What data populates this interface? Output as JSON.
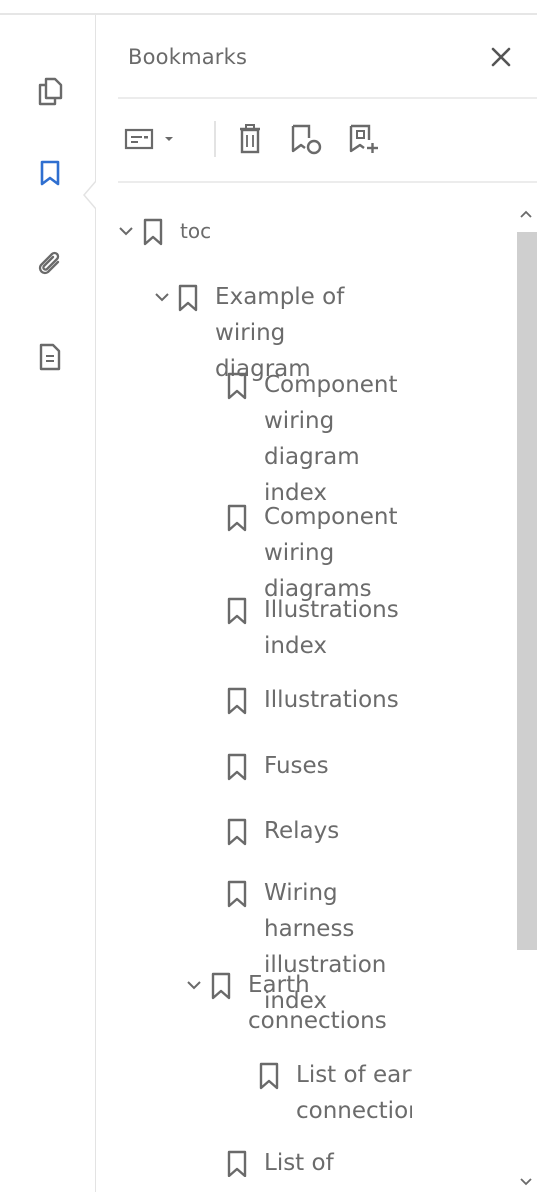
{
  "panel": {
    "title": "Bookmarks"
  },
  "colors": {
    "accent": "#2f6fd0",
    "icon": "#6a6a6a",
    "scroll_thumb": "#cfcfcf"
  },
  "rail": {
    "items": [
      {
        "name": "page-thumbnails-icon",
        "active": false
      },
      {
        "name": "bookmarks-icon",
        "active": true
      },
      {
        "name": "attachments-icon",
        "active": false
      },
      {
        "name": "document-properties-icon",
        "active": false
      }
    ]
  },
  "toolbar": {
    "buttons": [
      "options-icon",
      "delete-bookmark-icon",
      "new-bookmark-icon",
      "new-bookmark-from-structure-icon"
    ]
  },
  "tree": [
    {
      "label": "toc",
      "lines": [
        "toc"
      ],
      "expandable": true,
      "expanded": true
    },
    {
      "label": "Example of wiring diagram",
      "lines": [
        "Example of wiring",
        "diagram"
      ],
      "expandable": true,
      "expanded": true
    },
    {
      "label": "Component wiring diagram index",
      "lines": [
        "Component",
        "wiring diagram",
        "index"
      ],
      "expandable": false
    },
    {
      "label": "Component wiring diagrams",
      "lines": [
        "Component",
        "wiring diagrams"
      ],
      "expandable": false
    },
    {
      "label": "Illustrations index",
      "lines": [
        "Illustrations",
        "index"
      ],
      "expandable": false
    },
    {
      "label": "Illustrations",
      "lines": [
        "Illustrations"
      ],
      "expandable": false
    },
    {
      "label": "Fuses",
      "lines": [
        "Fuses"
      ],
      "expandable": false
    },
    {
      "label": "Relays",
      "lines": [
        "Relays"
      ],
      "expandable": false
    },
    {
      "label": "Wiring harness illustration index",
      "lines": [
        "Wiring harness",
        "illustration index"
      ],
      "expandable": false
    },
    {
      "label": "Earth connections",
      "lines": [
        "Earth",
        "connections"
      ],
      "expandable": true,
      "expanded": true
    },
    {
      "label": "List of earth connections",
      "lines": [
        "List of earth",
        "connections"
      ],
      "expandable": false
    },
    {
      "label": "List of",
      "lines": [
        "List of"
      ],
      "expandable": false
    }
  ]
}
